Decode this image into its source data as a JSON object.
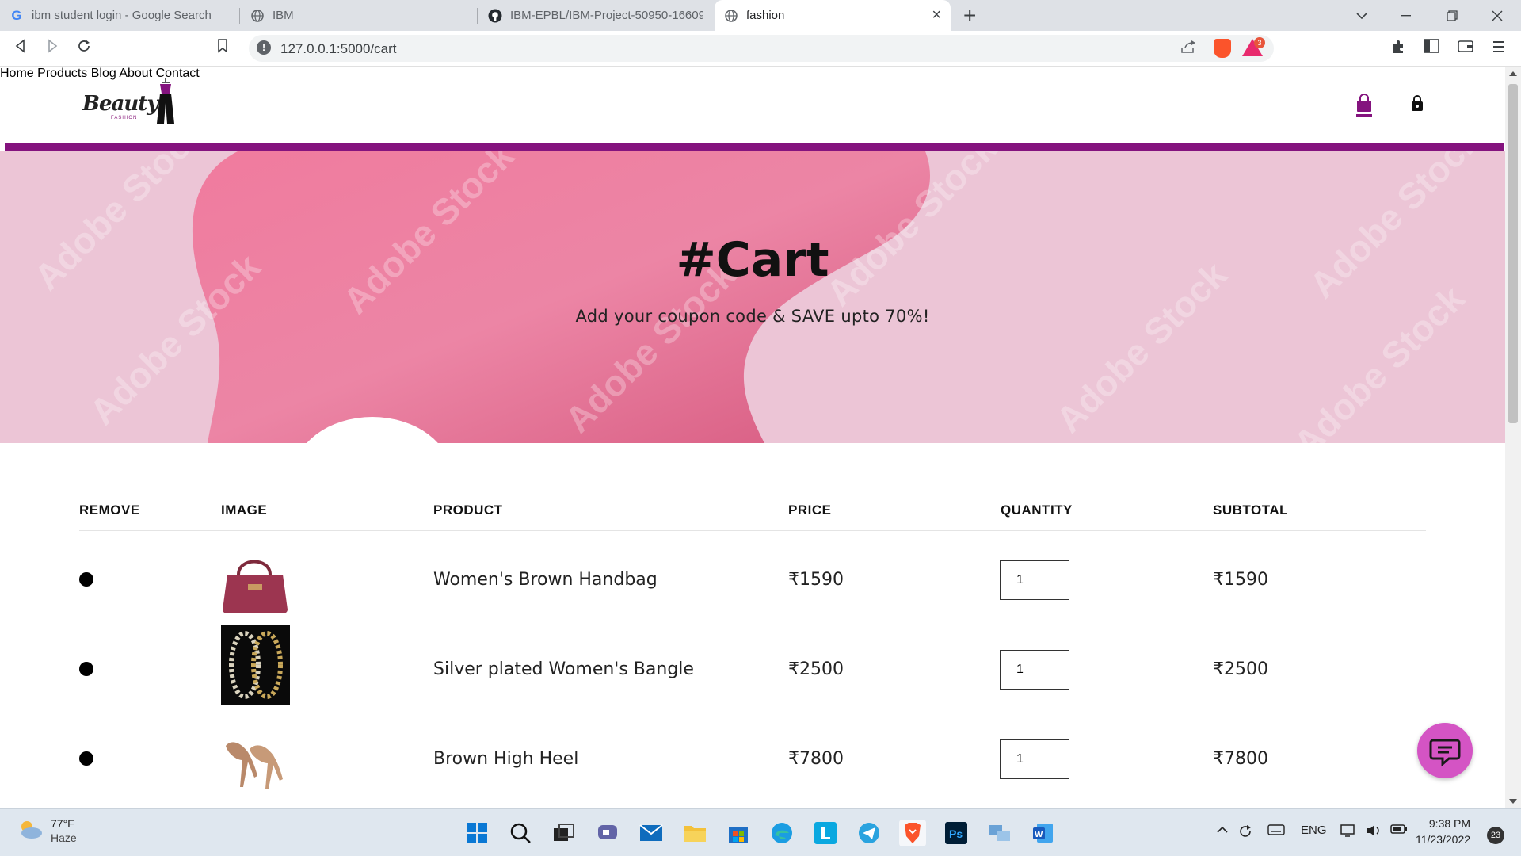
{
  "browser": {
    "tabs": [
      {
        "title": "ibm student login - Google Search",
        "icon": "google-icon"
      },
      {
        "title": "IBM",
        "icon": "globe-icon"
      },
      {
        "title": "IBM-EPBL/IBM-Project-50950-166093",
        "icon": "github-icon"
      },
      {
        "title": "fashion",
        "icon": "globe-icon",
        "active": true
      }
    ],
    "new_tab": "+",
    "url": "127.0.0.1:5000/cart",
    "rewards_badge": "3"
  },
  "site": {
    "logo_text": "Beauty",
    "logo_sub": "FASHION",
    "nav": [
      "Home",
      "Products",
      "Blog",
      "About",
      "Contact"
    ],
    "accent": "#84137e"
  },
  "banner": {
    "title": "#Cart",
    "subtitle": "Add your coupon code & SAVE upto 70%!",
    "watermark": "Adobe Stock",
    "bg_color": "#ecc5d6",
    "blob_color": "#e46f93"
  },
  "cart": {
    "headers": [
      "REMOVE",
      "IMAGE",
      "PRODUCT",
      "PRICE",
      "QUANTITY",
      "SUBTOTAL"
    ],
    "items": [
      {
        "name": "Women's Brown Handbag",
        "price": "₹1590",
        "quantity": "1",
        "subtotal": "₹1590",
        "image": "handbag"
      },
      {
        "name": "Silver plated Women's Bangle",
        "price": "₹2500",
        "quantity": "1",
        "subtotal": "₹2500",
        "image": "bangle"
      },
      {
        "name": "Brown High Heel",
        "price": "₹7800",
        "quantity": "1",
        "subtotal": "₹7800",
        "image": "high-heel"
      }
    ]
  },
  "chat": {
    "icon": "chat-icon",
    "color": "#d454c4"
  },
  "taskbar": {
    "weather_temp": "77°F",
    "weather_cond": "Haze",
    "lang": "ENG",
    "time": "9:38 PM",
    "date": "11/23/2022",
    "notifications": "23"
  }
}
